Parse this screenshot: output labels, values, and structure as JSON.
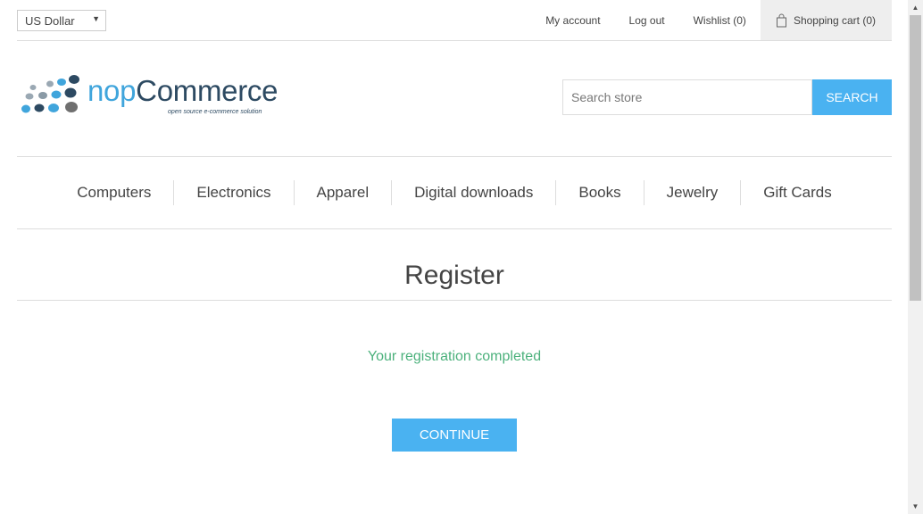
{
  "header": {
    "currency": "US Dollar",
    "links": {
      "my_account": "My account",
      "log_out": "Log out",
      "wishlist": "Wishlist (0)",
      "cart": "Shopping cart (0)"
    }
  },
  "logo": {
    "name_part1": "nop",
    "name_part2": "Commerce",
    "tagline": "open source e-commerce solution"
  },
  "search": {
    "placeholder": "Search store",
    "button": "SEARCH"
  },
  "menu": [
    "Computers",
    "Electronics",
    "Apparel",
    "Digital downloads",
    "Books",
    "Jewelry",
    "Gift Cards"
  ],
  "page": {
    "title": "Register",
    "result": "Your registration completed",
    "continue_label": "CONTINUE"
  },
  "colors": {
    "accent": "#4ab2f1",
    "success": "#4cb17c",
    "logo_dark": "#2d4a62"
  }
}
